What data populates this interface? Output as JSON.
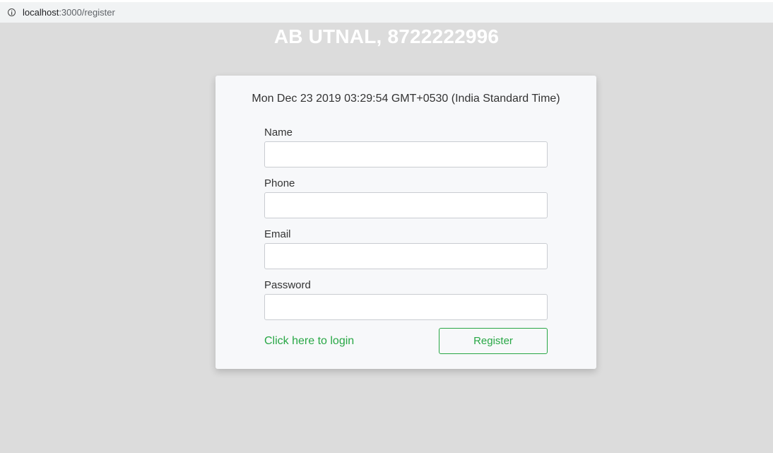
{
  "browser": {
    "url_host": "localhost",
    "url_path": ":3000/register",
    "info_icon": "info-icon"
  },
  "header": {
    "title": "AB UTNAL, 8722222996",
    "title_color": "#ffffff"
  },
  "card": {
    "timestamp": "Mon Dec 23 2019 03:29:54 GMT+0530 (India Standard Time)",
    "fields": [
      {
        "label": "Name",
        "value": "",
        "placeholder": ""
      },
      {
        "label": "Phone",
        "value": "",
        "placeholder": ""
      },
      {
        "label": "Email",
        "value": "",
        "placeholder": ""
      },
      {
        "label": "Password",
        "value": "",
        "placeholder": ""
      }
    ],
    "login_link": "Click here to login",
    "register_button": "Register"
  },
  "colors": {
    "background": "#dcdcdc",
    "card_background": "#f7f8fa",
    "accent": "#28a745"
  }
}
